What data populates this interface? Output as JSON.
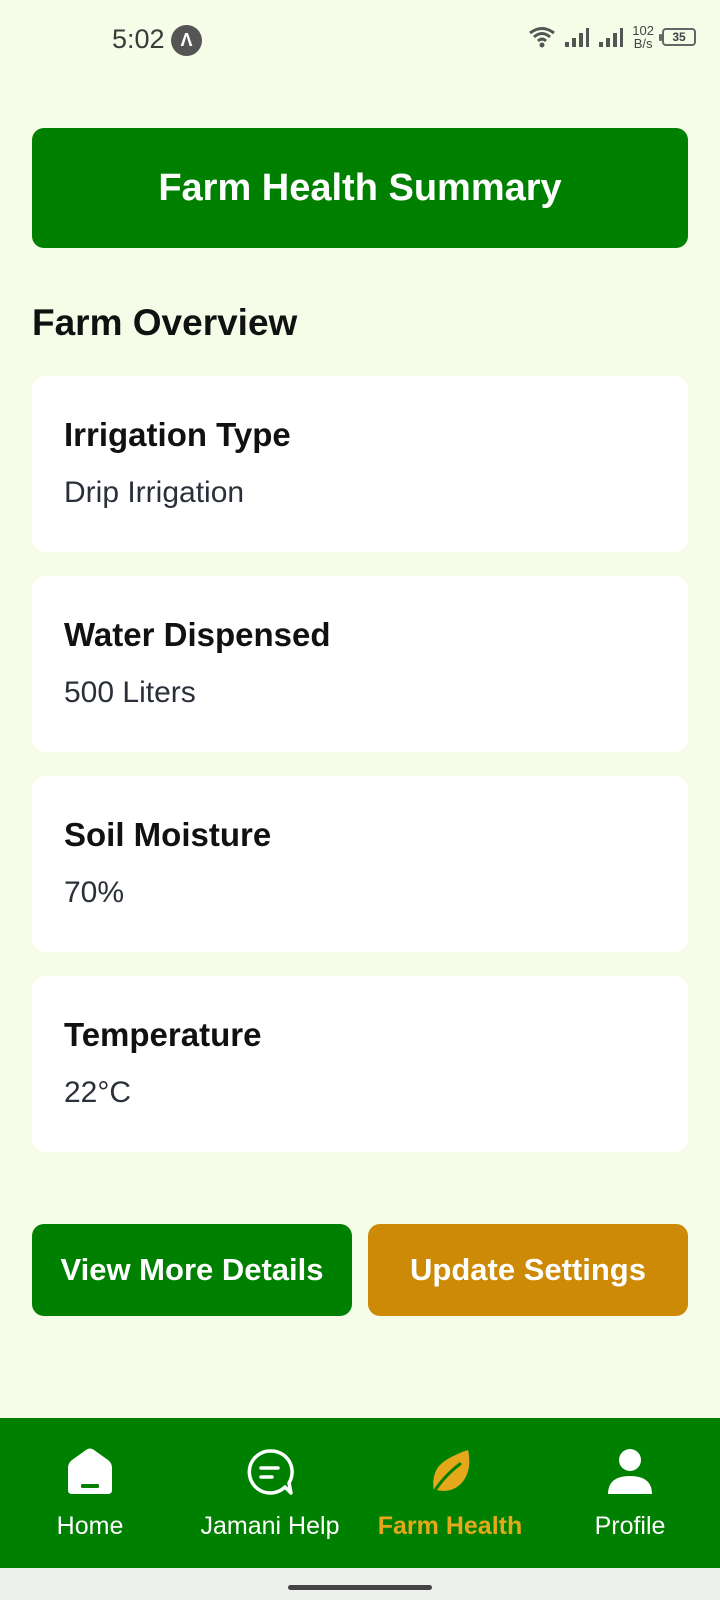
{
  "status_bar": {
    "time": "5:02",
    "app_badge": "Λ",
    "net_speed_value": "102",
    "net_speed_unit": "B/s",
    "battery": "35"
  },
  "header": {
    "title": "Farm Health Summary"
  },
  "overview": {
    "title": "Farm Overview",
    "cards": [
      {
        "label": "Irrigation Type",
        "value": "Drip Irrigation"
      },
      {
        "label": "Water Dispensed",
        "value": "500 Liters"
      },
      {
        "label": "Soil Moisture",
        "value": "70%"
      },
      {
        "label": "Temperature",
        "value": "22°C"
      }
    ]
  },
  "actions": {
    "view_details": "View More Details",
    "update_settings": "Update Settings",
    "primary_color": "#008000",
    "secondary_color": "#cc8a06"
  },
  "nav": {
    "items": [
      {
        "label": "Home",
        "icon": "home-icon"
      },
      {
        "label": "Jamani Help",
        "icon": "chat-icon"
      },
      {
        "label": "Farm Health",
        "icon": "leaf-icon",
        "active": true
      },
      {
        "label": "Profile",
        "icon": "profile-icon"
      }
    ],
    "active_color": "#e5a81a"
  }
}
